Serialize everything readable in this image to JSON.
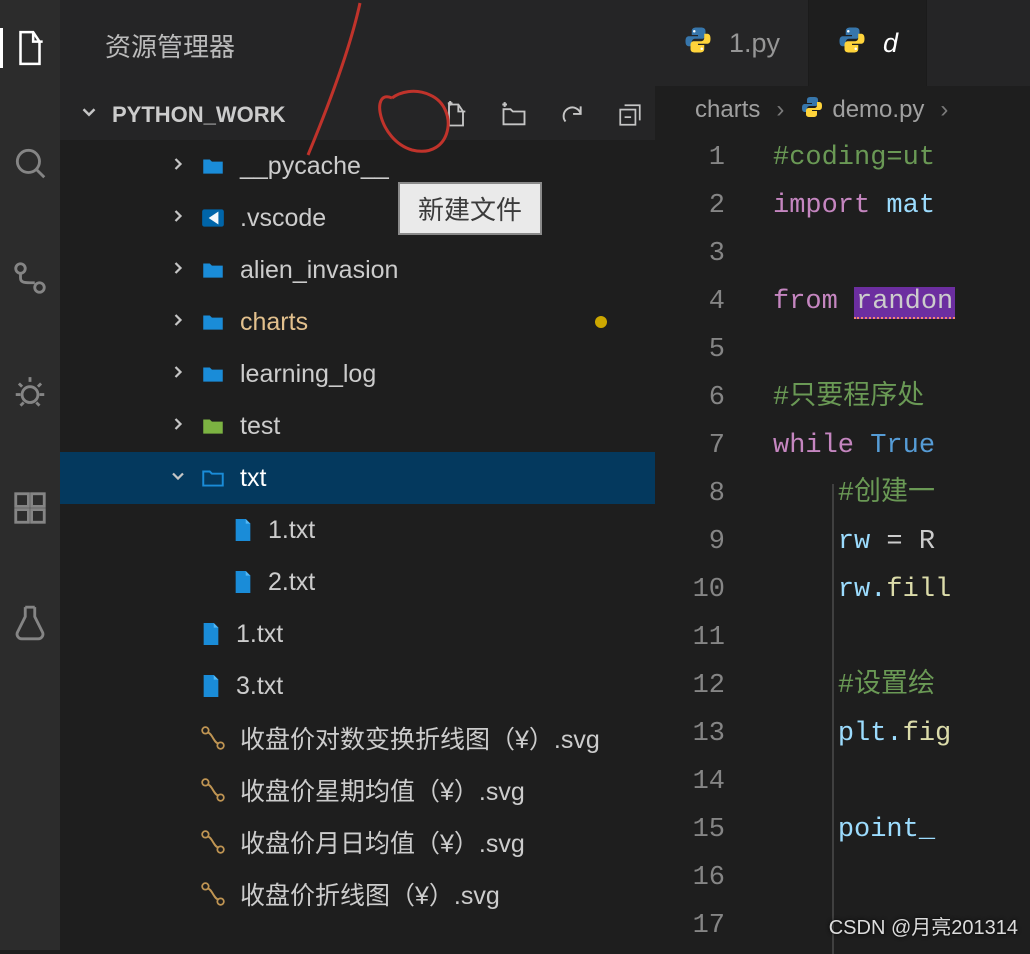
{
  "sidebar": {
    "title": "资源管理器",
    "section": "PYTHON_WORK",
    "tooltip": "新建文件",
    "tree": [
      {
        "label": "__pycache__",
        "type": "folder",
        "expand": false
      },
      {
        "label": ".vscode",
        "type": "vscode",
        "expand": false
      },
      {
        "label": "alien_invasion",
        "type": "folder",
        "expand": false
      },
      {
        "label": "charts",
        "type": "folder",
        "expand": false,
        "highlight": true,
        "modified": true
      },
      {
        "label": "learning_log",
        "type": "folder",
        "expand": false
      },
      {
        "label": "test",
        "type": "folder-green",
        "expand": false
      },
      {
        "label": "txt",
        "type": "folder-open",
        "expand": true,
        "selected": true
      },
      {
        "label": "1.txt",
        "type": "file",
        "depth": 2
      },
      {
        "label": "2.txt",
        "type": "file",
        "depth": 2
      },
      {
        "label": "1.txt",
        "type": "file"
      },
      {
        "label": "3.txt",
        "type": "file"
      },
      {
        "label": "收盘价对数变换折线图（¥）.svg",
        "type": "svg"
      },
      {
        "label": "收盘价星期均值（¥）.svg",
        "type": "svg"
      },
      {
        "label": "收盘价月日均值（¥）.svg",
        "type": "svg"
      },
      {
        "label": "收盘价折线图（¥）.svg",
        "type": "svg"
      }
    ]
  },
  "tabs": [
    {
      "label": "1.py",
      "active": false
    },
    {
      "label": "d",
      "active": true
    }
  ],
  "breadcrumb": {
    "a": "charts",
    "b": "demo.py"
  },
  "code": {
    "lines": [
      {
        "n": "1",
        "t": "comment",
        "text": "#coding=ut"
      },
      {
        "n": "2",
        "t": "import",
        "kw": "import",
        "rest": " mat"
      },
      {
        "n": "3",
        "t": "blank",
        "text": ""
      },
      {
        "n": "4",
        "t": "from",
        "kw": "from",
        "hl": "randon"
      },
      {
        "n": "5",
        "t": "blank",
        "text": ""
      },
      {
        "n": "6",
        "t": "comment",
        "text": "#只要程序处"
      },
      {
        "n": "7",
        "t": "while",
        "kw": "while",
        "val": "True"
      },
      {
        "n": "8",
        "t": "comment-indent",
        "text": "#创建一"
      },
      {
        "n": "9",
        "t": "assign",
        "lhs": "rw",
        "rhs": " = R"
      },
      {
        "n": "10",
        "t": "call",
        "obj": "rw.",
        "fn": "fill"
      },
      {
        "n": "11",
        "t": "blank",
        "text": ""
      },
      {
        "n": "12",
        "t": "comment-indent",
        "text": "#设置绘"
      },
      {
        "n": "13",
        "t": "call",
        "obj": "plt.",
        "fn": "fig"
      },
      {
        "n": "14",
        "t": "blank",
        "text": ""
      },
      {
        "n": "15",
        "t": "var",
        "text": "point_"
      },
      {
        "n": "16",
        "t": "blank",
        "text": ""
      },
      {
        "n": "17",
        "t": "blank",
        "text": ""
      }
    ]
  },
  "watermark": "CSDN @月亮201314"
}
